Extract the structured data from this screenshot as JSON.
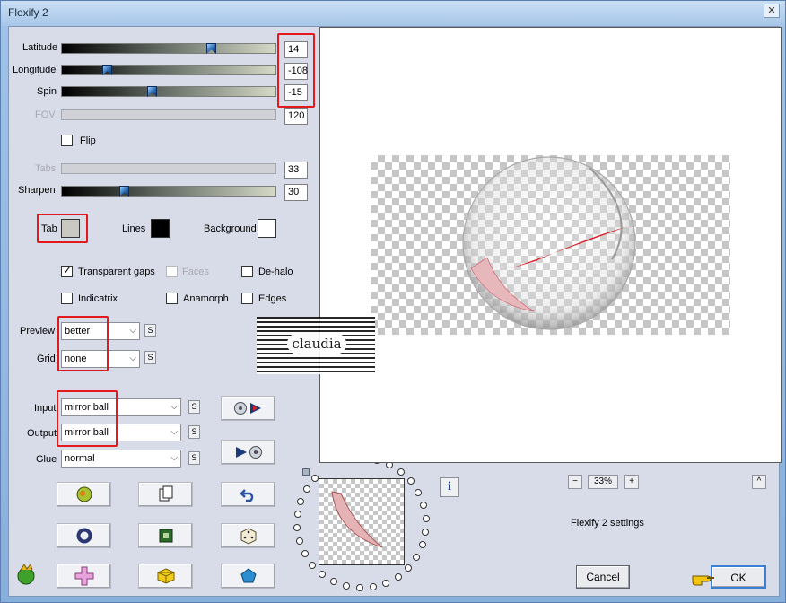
{
  "window": {
    "title": "Flexify 2",
    "close_glyph": "✕"
  },
  "sliders": [
    {
      "label": "Latitude",
      "value": "14",
      "fraction": 0.71
    },
    {
      "label": "Longitude",
      "value": "-108",
      "fraction": 0.2
    },
    {
      "label": "Spin",
      "value": "-15",
      "fraction": 0.42
    },
    {
      "label": "FOV",
      "value": "120",
      "disabled": true
    },
    {
      "label": "Tabs",
      "value": "33",
      "disabled": true
    },
    {
      "label": "Sharpen",
      "value": "30",
      "fraction": 0.28
    }
  ],
  "flip": {
    "label": "Flip",
    "checked": false
  },
  "colors": {
    "tab_label": "Tab",
    "tab_color": "#c9c9c2",
    "lines_label": "Lines",
    "lines_color": "#000000",
    "background_label": "Background",
    "background_color": "#ffffff",
    "highlight": "#e3191e"
  },
  "options": {
    "transparent_gaps": {
      "label": "Transparent gaps",
      "checked": true
    },
    "faces": {
      "label": "Faces",
      "checked": false,
      "disabled": true
    },
    "de_halo": {
      "label": "De-halo",
      "checked": false
    },
    "indicatrix": {
      "label": "Indicatrix",
      "checked": false
    },
    "anamorph": {
      "label": "Anamorph",
      "checked": false
    },
    "edges": {
      "label": "Edges",
      "checked": false
    }
  },
  "preview": {
    "label": "Preview",
    "value": "better"
  },
  "grid": {
    "label": "Grid",
    "value": "none"
  },
  "input": {
    "label": "Input",
    "value": "mirror ball"
  },
  "output": {
    "label": "Output",
    "value": "mirror ball"
  },
  "glue": {
    "label": "Glue",
    "value": "normal"
  },
  "small_button_label": "S",
  "zoom": {
    "minus": "−",
    "value": "33%",
    "plus": "+"
  },
  "settings_label": "Flexify 2 settings",
  "scroll_up": "^",
  "info_glyph": "i",
  "cancel_label": "Cancel",
  "ok_label": "OK",
  "watermark": {
    "text": "claudia"
  },
  "icons": [
    "fox-icon",
    "copy-icon",
    "undo-icon",
    "ring-icon",
    "frame-icon",
    "dice-icon",
    "app-logo-icon",
    "cross-icon",
    "cube-icon",
    "gem-icon",
    "pointing-hand-icon"
  ]
}
